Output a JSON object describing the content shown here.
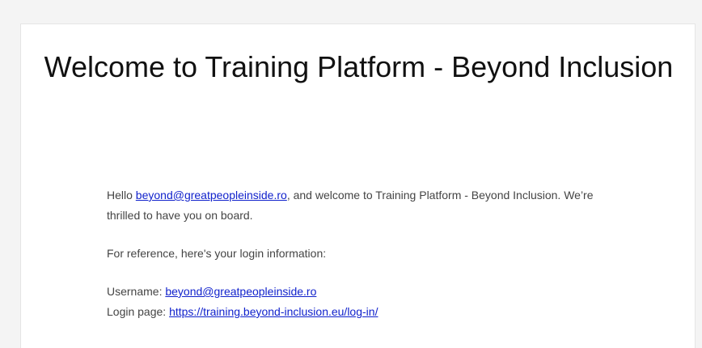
{
  "email": {
    "title": "Welcome to Training Platform - Beyond Inclusion",
    "greeting_prefix": "Hello ",
    "greeting_email": "beyond@greatpeopleinside.ro",
    "greeting_suffix": ", and welcome to Training Platform - Beyond Inclusion. We’re thrilled to have you on board.",
    "reference_text": "For reference, here's your login information:",
    "username_label": "Username: ",
    "username_value": "beyond@greatpeopleinside.ro",
    "login_label": "Login page: ",
    "login_url": "https://training.beyond-inclusion.eu/log-in/"
  },
  "colors": {
    "background": "#f4f4f4",
    "card": "#ffffff",
    "link": "#1122cc",
    "text": "#444444",
    "heading": "#111111"
  }
}
